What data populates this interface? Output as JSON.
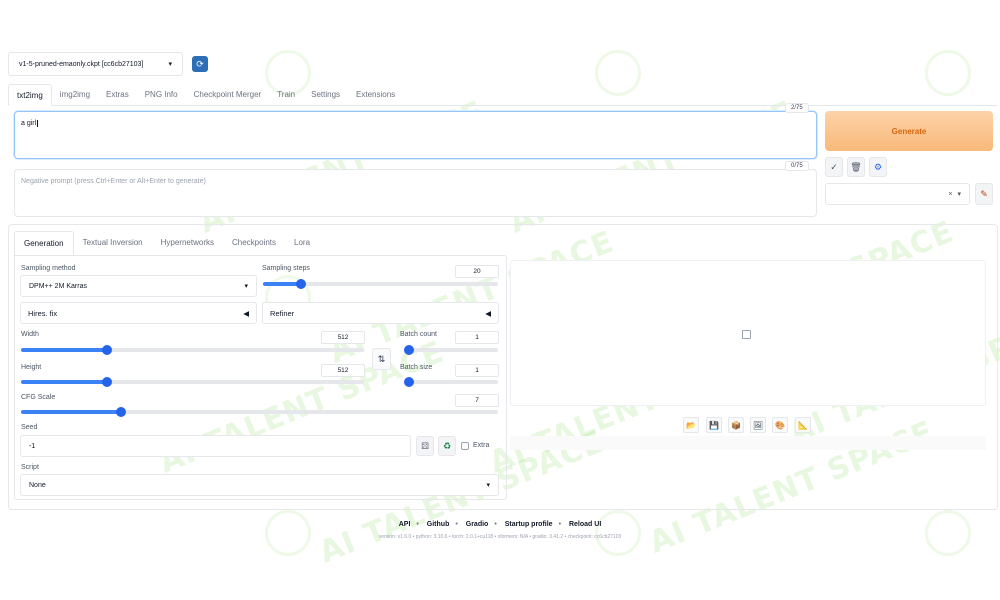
{
  "checkpoint": {
    "value": "v1-5-pruned-emaonly.ckpt [cc6cb27103]",
    "refresh_icon": "refresh-icon"
  },
  "tabs": [
    {
      "label": "txt2img",
      "active": true
    },
    {
      "label": "img2img"
    },
    {
      "label": "Extras"
    },
    {
      "label": "PNG Info"
    },
    {
      "label": "Checkpoint Merger"
    },
    {
      "label": "Train"
    },
    {
      "label": "Settings"
    },
    {
      "label": "Extensions"
    }
  ],
  "prompt": {
    "value": "a girl",
    "counter": "2/75"
  },
  "negative_prompt": {
    "placeholder": "Negative prompt (press Ctrl+Enter or Alt+Enter to generate)",
    "counter": "0/75"
  },
  "generate": {
    "label": "Generate"
  },
  "tools": {
    "apply_icon": "✓",
    "trash_icon": "🗑",
    "settings_icon": "⚙",
    "clear_icon": "×",
    "dropdown_icon": "▾",
    "edit_icon": "✎"
  },
  "subtabs": [
    {
      "label": "Generation",
      "active": true
    },
    {
      "label": "Textual Inversion"
    },
    {
      "label": "Hypernetworks"
    },
    {
      "label": "Checkpoints"
    },
    {
      "label": "Lora"
    }
  ],
  "params": {
    "sampling_method": {
      "label": "Sampling method",
      "value": "DPM++ 2M Karras"
    },
    "sampling_steps": {
      "label": "Sampling steps",
      "value": "20",
      "fraction": 0.16
    },
    "hires_fix": {
      "label": "Hires. fix"
    },
    "refiner": {
      "label": "Refiner"
    },
    "width": {
      "label": "Width",
      "value": "512",
      "fraction": 0.25
    },
    "height": {
      "label": "Height",
      "value": "512",
      "fraction": 0.25
    },
    "batch_count": {
      "label": "Batch count",
      "value": "1",
      "fraction": 0.0
    },
    "batch_size": {
      "label": "Batch size",
      "value": "1",
      "fraction": 0.0
    },
    "cfg_scale": {
      "label": "CFG Scale",
      "value": "7",
      "fraction": 0.21
    },
    "seed": {
      "label": "Seed",
      "value": "-1",
      "extra_label": "Extra"
    },
    "script": {
      "label": "Script",
      "value": "None"
    }
  },
  "footer": {
    "links": [
      "API",
      "Github",
      "Gradio",
      "Startup profile",
      "Reload UI"
    ],
    "version": "version: v1.6.0  •  python: 3.10.6  •  torch: 2.0.1+cu118  •  xformers: N/A  •  gradio: 3.41.2  •  checkpoint: cc6cb27103"
  },
  "watermark": {
    "text": "AI TALENT SPACE",
    "color": "#96dc6e"
  },
  "colors": {
    "accent": "#2563eb",
    "generate_bg": "#f9b97a",
    "generate_text": "#d9650c"
  }
}
